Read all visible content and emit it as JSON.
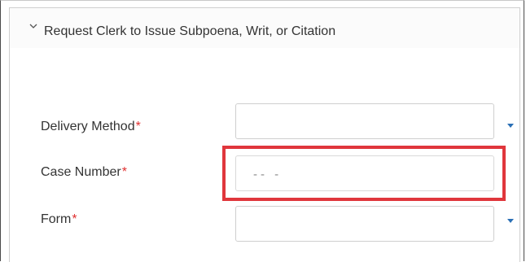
{
  "section": {
    "title": "Request Clerk to Issue Subpoena, Writ, or Citation",
    "expanded_icon": "chevron-down-icon"
  },
  "fields": {
    "delivery_method": {
      "label": "Delivery Method",
      "required_mark": "*",
      "value": "",
      "type": "dropdown"
    },
    "case_number": {
      "label": "Case Number",
      "required_mark": "*",
      "value": "-- -",
      "type": "masked-input",
      "highlighted": true
    },
    "form": {
      "label": "Form",
      "required_mark": "*",
      "value": "",
      "type": "dropdown"
    }
  },
  "colors": {
    "required": "#e03030",
    "highlight": "#e0363c",
    "dropdown_arrow": "#2a6fb5",
    "border": "#cfcfcf"
  }
}
